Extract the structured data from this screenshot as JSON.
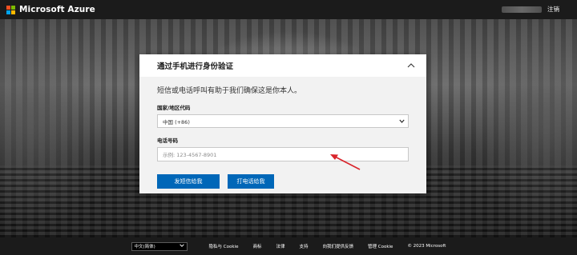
{
  "header": {
    "brand": "Microsoft Azure",
    "sign_out_label": "注销"
  },
  "dialog": {
    "title": "通过手机进行身份验证",
    "intro": "短信或电话呼叫有助于我们确保这是你本人。",
    "country_label": "国家/地区代码",
    "country_value": "中国 (+86)",
    "phone_label": "电话号码",
    "phone_placeholder": "示例: 123-4567-8901",
    "phone_value": "",
    "sms_button": "发短信给我",
    "call_button": "打电话给我"
  },
  "footer": {
    "language": "中文(简体)",
    "links": [
      "隐私与 Cookie",
      "商标",
      "法律",
      "支持",
      "向我们提供反馈",
      "管理 Cookie"
    ],
    "copyright": "© 2023 Microsoft"
  },
  "colors": {
    "accent": "#0067b8",
    "annotation": "#d9242b",
    "logo_red": "#f25022",
    "logo_green": "#7fba00",
    "logo_blue": "#00a4ef",
    "logo_yellow": "#ffb900"
  },
  "icons": [
    "microsoft-logo",
    "chevron-up-icon",
    "chevron-down-icon"
  ]
}
